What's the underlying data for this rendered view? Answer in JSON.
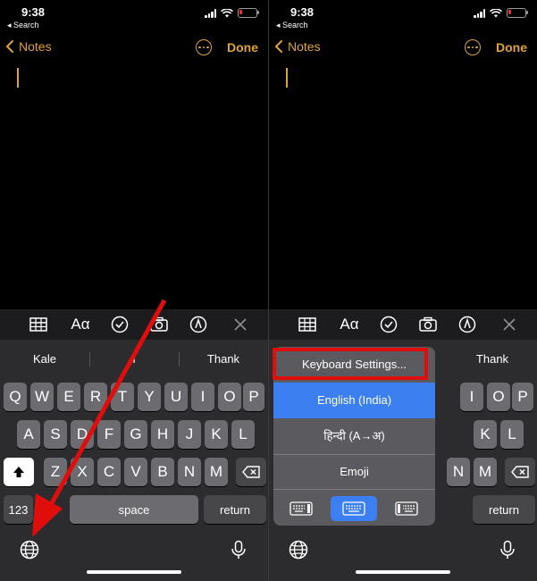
{
  "status": {
    "time": "9:38",
    "back_label": "◂ Search"
  },
  "nav": {
    "back_label": "Notes",
    "done_label": "Done"
  },
  "predictions_left": [
    "Kale",
    "I",
    "Thank"
  ],
  "predictions_right": [
    "Thank"
  ],
  "keys": {
    "row1": [
      "Q",
      "W",
      "E",
      "R",
      "T",
      "Y",
      "U",
      "I",
      "O",
      "P"
    ],
    "row2": [
      "A",
      "S",
      "D",
      "F",
      "G",
      "H",
      "J",
      "K",
      "L"
    ],
    "row3": [
      "Z",
      "X",
      "C",
      "V",
      "B",
      "N",
      "M"
    ],
    "numbers_label": "123",
    "space_label": "space",
    "return_label": "return"
  },
  "keys_right": {
    "row1": [
      "P",
      "O",
      "I"
    ],
    "row2": [
      "L",
      "K"
    ],
    "row3": [
      "N",
      "M"
    ],
    "return_label": "return"
  },
  "toolbar": {
    "format_label": "Aα"
  },
  "popup": {
    "settings_label": "Keyboard Settings...",
    "languages": [
      "English (India)",
      "हिन्दी (A→अ)",
      "Emoji"
    ],
    "selected_index": 0,
    "keyboard_modes": [
      "left-keyboard-icon",
      "full-keyboard-icon",
      "right-keyboard-icon"
    ],
    "selected_mode": 1
  },
  "colors": {
    "accent": "#e0a42a",
    "selected": "#3b7ff0",
    "annotation": "#e00d0d"
  },
  "battery_level": 0.15
}
